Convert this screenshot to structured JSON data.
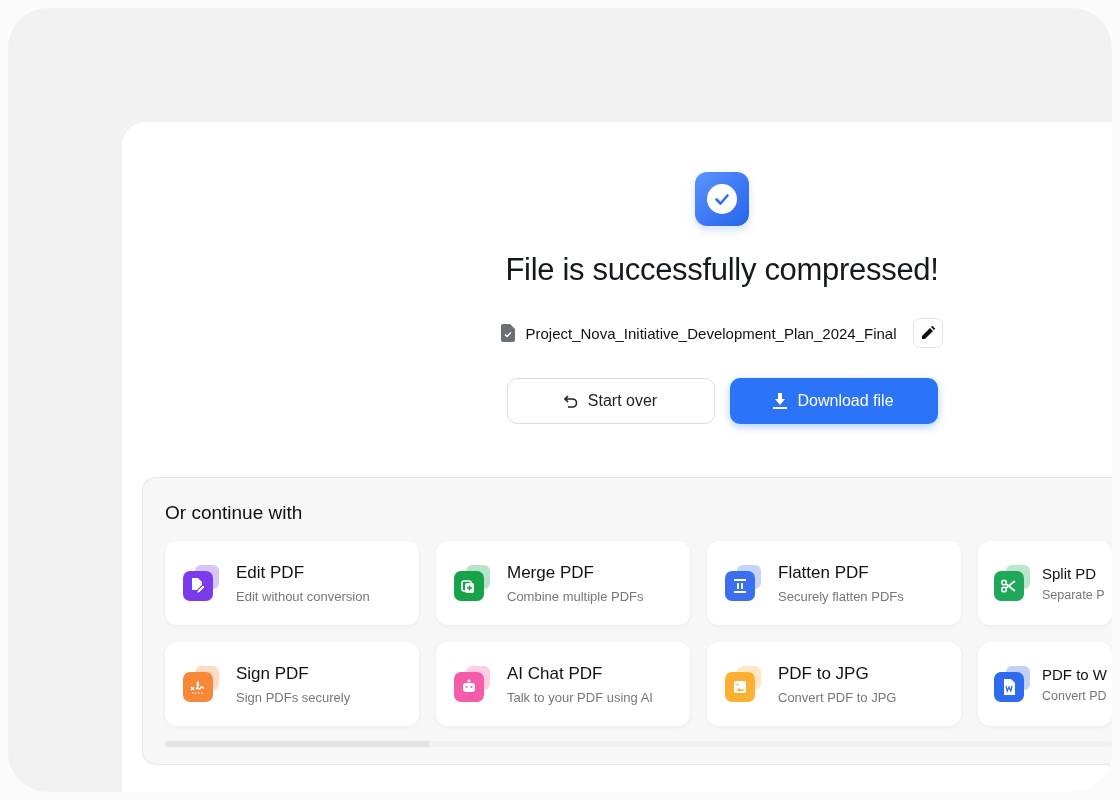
{
  "result": {
    "title": "File is successfully compressed!",
    "file_name": "Project_Nova_Initiative_Development_Plan_2024_Final"
  },
  "buttons": [
    {
      "kind": "secondary",
      "label": "Start over"
    },
    {
      "kind": "primary",
      "label": "Download file"
    }
  ],
  "continue_panel": {
    "heading": "Or continue with",
    "tools": [
      {
        "kind": "edit",
        "color": "#7c3aed",
        "title": "Edit PDF",
        "subtitle": "Edit without conversion"
      },
      {
        "kind": "merge",
        "color": "#16a34a",
        "title": "Merge PDF",
        "subtitle": "Combine multiple PDFs"
      },
      {
        "kind": "flatten",
        "color": "#3b6ff0",
        "title": "Flatten PDF",
        "subtitle": "Securely flatten PDFs"
      },
      {
        "kind": "split",
        "color": "#1fa85a",
        "title": "Split PD",
        "subtitle": "Separate P"
      },
      {
        "kind": "sign",
        "color": "#f7883a",
        "title": "Sign PDF",
        "subtitle": "Sign PDFs securely"
      },
      {
        "kind": "chat",
        "color": "#f25ca8",
        "title": "AI Chat PDF",
        "subtitle": "Talk to your PDF using AI"
      },
      {
        "kind": "image",
        "color": "#fbb034",
        "title": "PDF to JPG",
        "subtitle": "Convert PDF to JPG"
      },
      {
        "kind": "word",
        "color": "#2f6bef",
        "title": "PDF to W",
        "subtitle": "Convert PD"
      }
    ]
  }
}
